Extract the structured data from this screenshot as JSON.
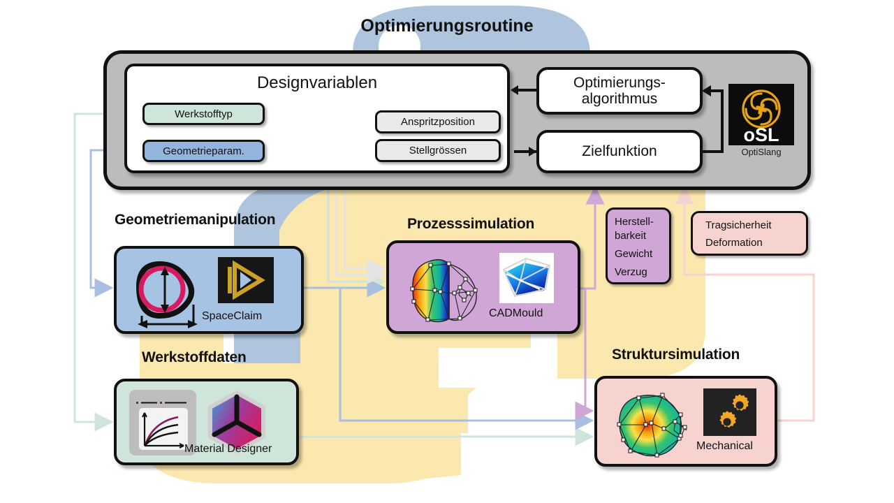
{
  "title": "Optimierungsroutine",
  "optimization_routine": {
    "designvariables": {
      "title": "Designvariablen",
      "chips": [
        {
          "label": "Werkstofftyp",
          "color": "#cfe5da"
        },
        {
          "label": "Geometrieparam.",
          "color": "#93b4dd"
        },
        {
          "label": "Anspritzposition",
          "color": "#e9e9e9"
        },
        {
          "label": "Stellgrössen",
          "color": "#e9e9e9"
        }
      ]
    },
    "algorithm_box": {
      "line1": "Optimierungs-",
      "line2": "algorithmus"
    },
    "objective_box": {
      "label": "Zielfunktion"
    },
    "solver": {
      "name": "OptiSlang",
      "logo_text": "oSL",
      "logo_bg": "#0c0c0c",
      "logo_fg": "#e8a317"
    }
  },
  "sections": [
    {
      "caption": "Geometriemanipulation",
      "tool": "SpaceClaim",
      "color": "#a7c3e3"
    },
    {
      "caption": "Prozesssimulation",
      "tool": "CADMould",
      "color": "#cfa6d6"
    },
    {
      "caption": "Werkstoffdaten",
      "tool": "Material Designer",
      "color": "#cfe5d9"
    },
    {
      "caption": "Struktursimulation",
      "tool": "Mechanical",
      "color": "#f7d3d0"
    }
  ],
  "criteria": {
    "process": {
      "lines": [
        "Herstell-",
        "barkeit",
        "Gewicht",
        "Verzug"
      ],
      "color": "#cfa6d6"
    },
    "structure": {
      "lines": [
        "Tragsicherheit",
        "Deformation"
      ],
      "color": "#f7d3d0"
    }
  },
  "colors": {
    "shell_grey": "#bcbcbc",
    "python_yellow": "#fbe8ae",
    "python_blue": "#aec5dd",
    "wire_green": "#cfe5da",
    "wire_blue": "#a9bfdf",
    "wire_grey": "#e4e4e4",
    "wire_purple": "#cfa6d6",
    "wire_pink": "#f7d3d0",
    "stroke": "#111111"
  }
}
